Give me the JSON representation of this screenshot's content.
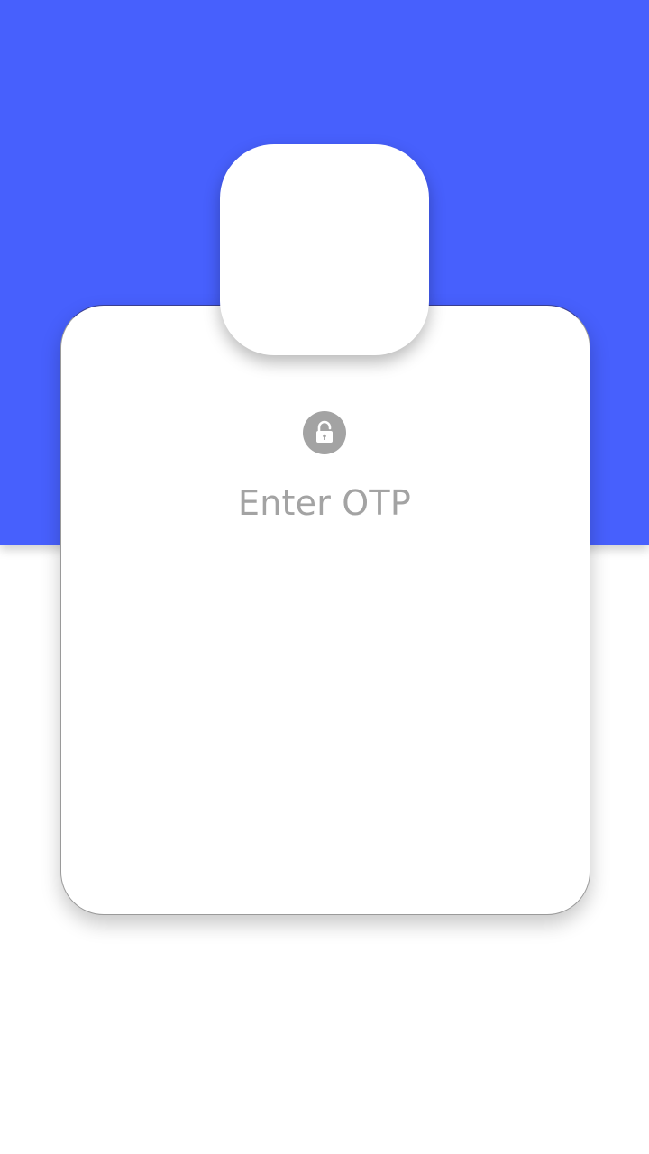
{
  "colors": {
    "banner": "#4760fd",
    "card": "#ffffff",
    "icon_gray": "#a3a3a3",
    "text_gray": "#a3a3a3"
  },
  "icons": {
    "lock": "lock-open-icon"
  },
  "card": {
    "title": "Enter OTP"
  }
}
